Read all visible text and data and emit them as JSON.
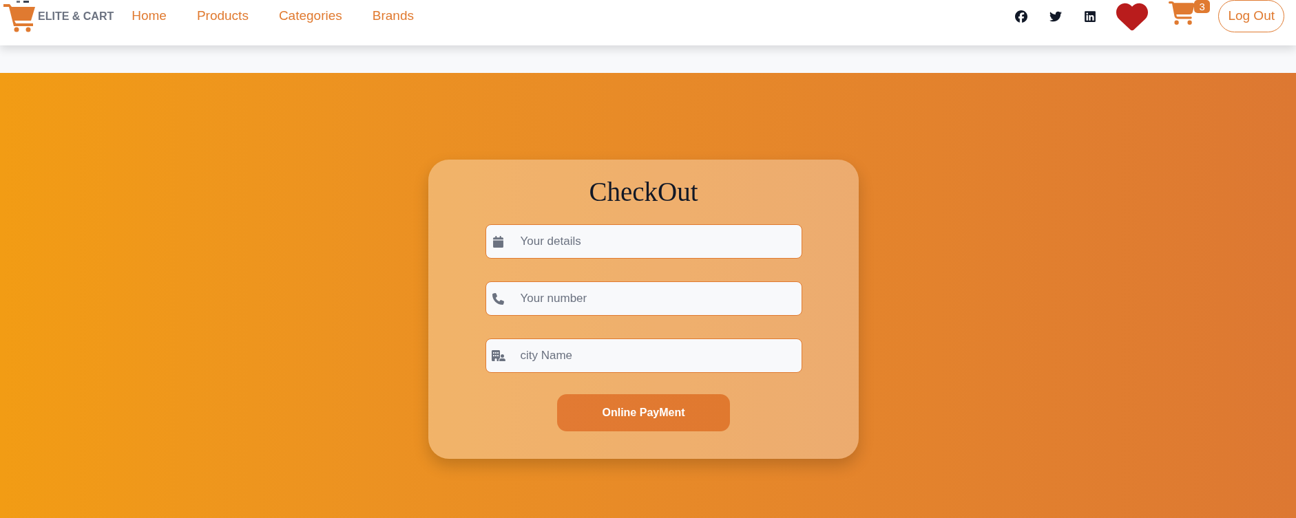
{
  "navbar": {
    "logo_text": "ELITE & CART",
    "links": [
      {
        "label": "Home"
      },
      {
        "label": "Products"
      },
      {
        "label": "Categories"
      },
      {
        "label": "Brands"
      }
    ],
    "cart_count": "3",
    "logout_button": "Log Out"
  },
  "checkout": {
    "title": "CheckOut",
    "fields": [
      {
        "placeholder": "Your details"
      },
      {
        "placeholder": "Your number"
      },
      {
        "placeholder": "city Name"
      }
    ],
    "submit_button": "Online PayMent"
  }
}
